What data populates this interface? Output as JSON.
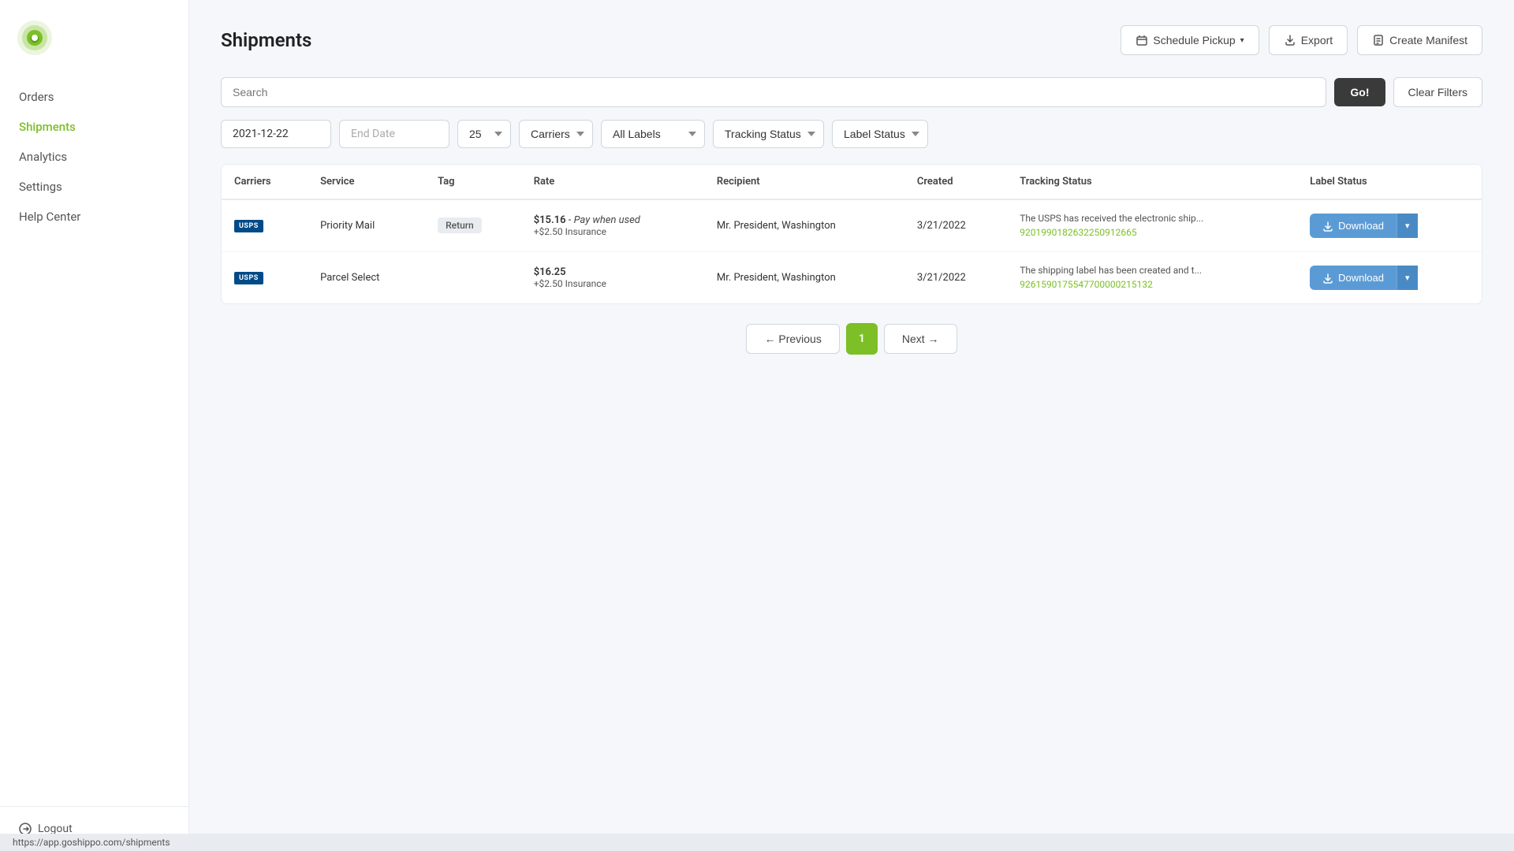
{
  "sidebar": {
    "logo_alt": "GoShippo Logo",
    "items": [
      {
        "label": "Orders",
        "id": "orders",
        "active": false
      },
      {
        "label": "Shipments",
        "id": "shipments",
        "active": true
      },
      {
        "label": "Analytics",
        "id": "analytics",
        "active": false
      },
      {
        "label": "Settings",
        "id": "settings",
        "active": false
      },
      {
        "label": "Help Center",
        "id": "help-center",
        "active": false
      }
    ],
    "logout_label": "Logout"
  },
  "page": {
    "title": "Shipments"
  },
  "header_buttons": {
    "schedule_pickup": "Schedule Pickup",
    "export": "Export",
    "create_manifest": "Create Manifest"
  },
  "filters": {
    "search_placeholder": "Search",
    "go_label": "Go!",
    "clear_label": "Clear Filters",
    "start_date": "2021-12-22",
    "end_date_placeholder": "End Date",
    "per_page": "25",
    "carriers": "Carriers",
    "all_labels": "All Labels",
    "tracking_status": "Tracking Status",
    "label_status": "Label Status"
  },
  "table": {
    "columns": [
      "Carriers",
      "Service",
      "Tag",
      "Rate",
      "Recipient",
      "Created",
      "Tracking Status",
      "Label Status"
    ],
    "rows": [
      {
        "carrier": "USPS",
        "service": "Priority Mail",
        "tag": "Return",
        "rate_main": "$15.16",
        "rate_note": "Pay when used",
        "rate_sub": "+$2.50 Insurance",
        "recipient": "Mr. President, Washington",
        "created": "3/21/2022",
        "tracking_text": "The USPS has received the electronic ship...",
        "tracking_number": "9201990182632250912665",
        "tracking_url": "#",
        "download_label": "Download"
      },
      {
        "carrier": "USPS",
        "service": "Parcel Select",
        "tag": "",
        "rate_main": "$16.25",
        "rate_note": "",
        "rate_sub": "+$2.50 Insurance",
        "recipient": "Mr. President, Washington",
        "created": "3/21/2022",
        "tracking_text": "The shipping label has been created and t...",
        "tracking_number": "9261590175547700000215132",
        "tracking_url": "#",
        "download_label": "Download"
      }
    ]
  },
  "pagination": {
    "previous_label": "← Previous",
    "next_label": "Next →",
    "current_page": 1,
    "pages": [
      1
    ]
  },
  "status_bar": {
    "url": "https://app.goshippo.com/shipments"
  }
}
